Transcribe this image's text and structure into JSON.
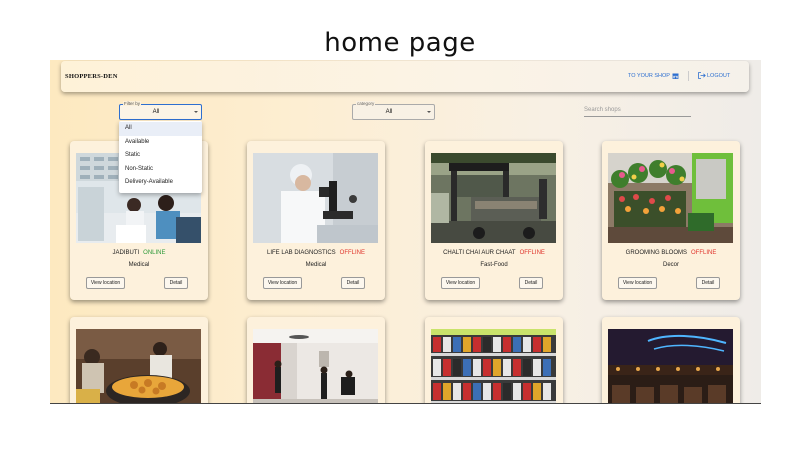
{
  "caption": "home page",
  "navbar": {
    "brand": "SHOPPERS-DEN",
    "to_your_shop": "TO YOUR SHOP",
    "logout": "LOGOUT"
  },
  "filter": {
    "legend": "Filter by",
    "value": "All",
    "options": [
      "All",
      "Available",
      "Static",
      "Non-Static",
      "Delivery-Available"
    ]
  },
  "category": {
    "legend": "category",
    "value": "All"
  },
  "search": {
    "placeholder": "Search shops"
  },
  "buttons": {
    "view_location": "View location",
    "detail": "Detail"
  },
  "shops": [
    {
      "name": "JADIBUTI",
      "status": "ONLINE",
      "category": "Medical"
    },
    {
      "name": "LIFE LAB DIAGNOSTICS",
      "status": "OFFLINE",
      "category": "Medical"
    },
    {
      "name": "CHALTI CHAI AUR CHAAT",
      "status": "OFFLINE",
      "category": "Fast-Food"
    },
    {
      "name": "GROOMING BLOOMS",
      "status": "OFFLINE",
      "category": "Decor"
    }
  ],
  "colors": {
    "online": "#2e9a3a",
    "offline": "#e0342b",
    "accent": "#2d6fd0"
  }
}
